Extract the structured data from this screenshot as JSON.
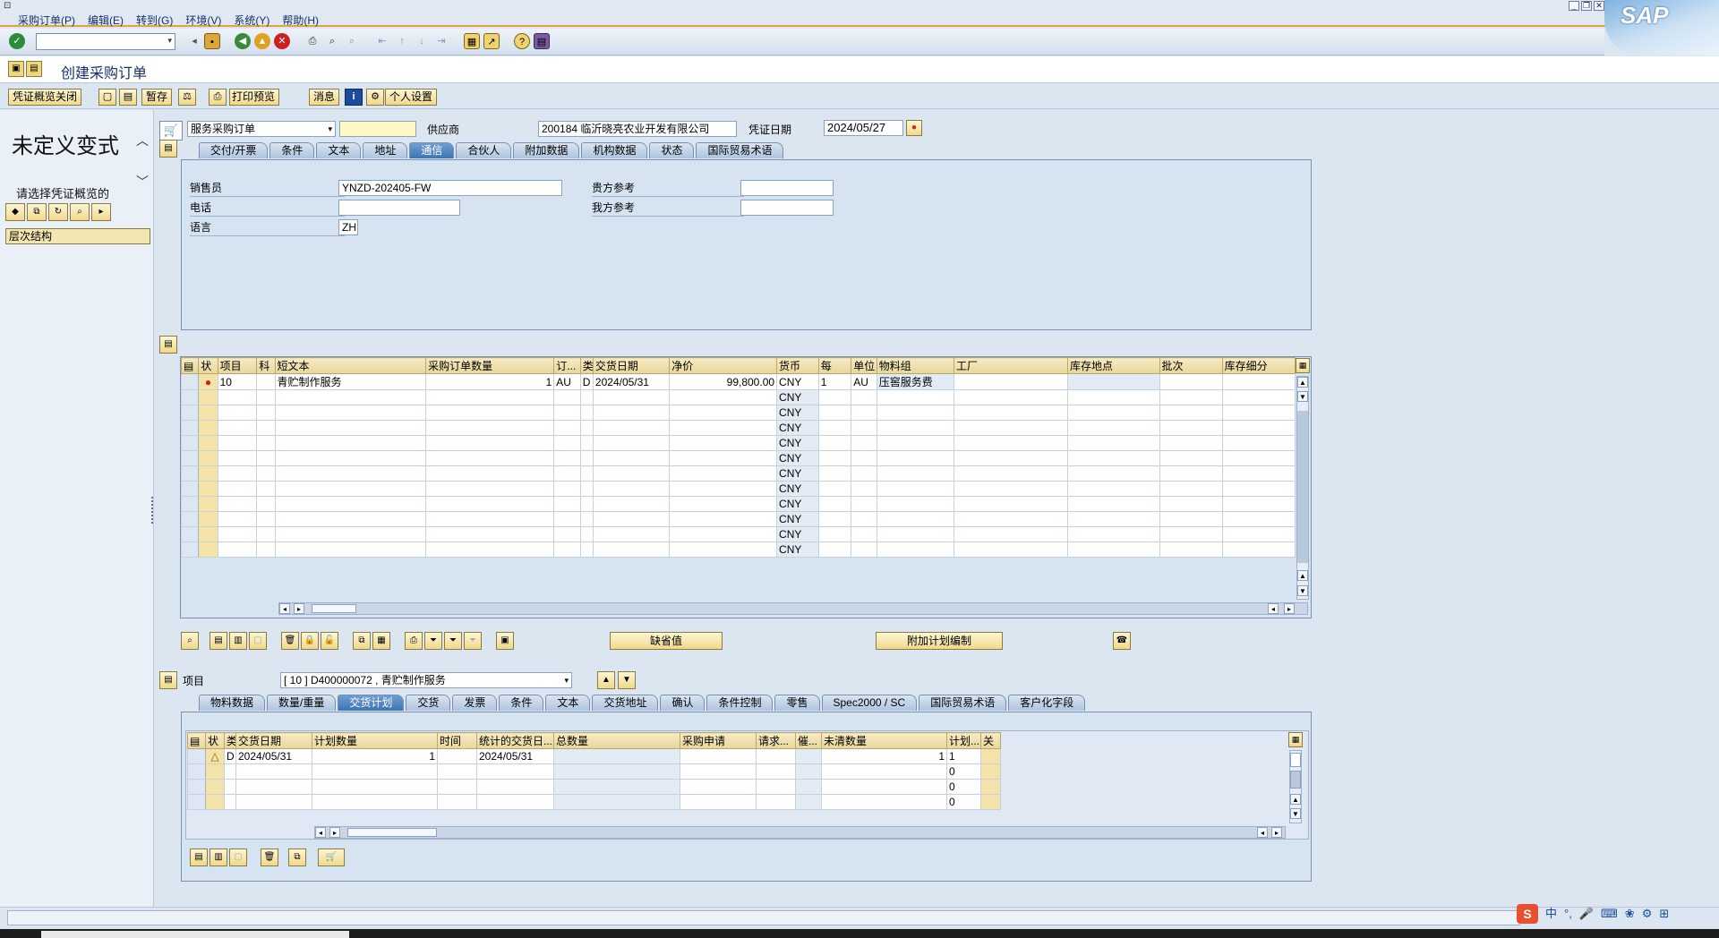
{
  "menu": [
    "采购订单(P)",
    "编辑(E)",
    "转到(G)",
    "环境(V)",
    "系统(Y)",
    "帮助(H)"
  ],
  "brand": "SAP",
  "title": "创建采购订单",
  "app_toolbar": {
    "overview_close": "凭证概览关闭",
    "hold": "暂存",
    "print_preview": "打印预览",
    "messages": "消息",
    "personal_settings": "个人设置"
  },
  "left_panel": {
    "title": "未定义变式",
    "prompt": "请选择凭证概览的",
    "tree_header": "层次结构"
  },
  "header": {
    "doc_type": "服务采购订单",
    "supplier_label": "供应商",
    "supplier_value": "200184 临沂晓亮农业开发有限公司",
    "doc_date_label": "凭证日期",
    "doc_date_value": "2024/05/27"
  },
  "header_tabs": [
    "交付/开票",
    "条件",
    "文本",
    "地址",
    "通信",
    "合伙人",
    "附加数据",
    "机构数据",
    "状态",
    "国际贸易术语"
  ],
  "header_active_tab": "通信",
  "communication": {
    "salesperson_label": "销售员",
    "salesperson_value": "YNZD-202405-FW",
    "phone_label": "电话",
    "language_label": "语言",
    "language_value": "ZH",
    "your_ref_label": "贵方参考",
    "our_ref_label": "我方参考"
  },
  "item_grid": {
    "columns": [
      "状",
      "项目",
      "科",
      "短文本",
      "采购订单数量",
      "订...",
      "类",
      "交货日期",
      "净价",
      "货币",
      "每",
      "单位",
      "物料组",
      "工厂",
      "库存地点",
      "批次",
      "库存细分"
    ],
    "row": {
      "item": "10",
      "short_text": "青贮制作服务",
      "qty": "1",
      "uom": "AU",
      "cat": "D",
      "delivery_date": "2024/05/31",
      "net_price": "99,800.00",
      "currency": "CNY",
      "per": "1",
      "unit": "AU",
      "material_group": "压窖服务费"
    },
    "empty_currency": "CNY"
  },
  "item_buttons": {
    "default_values": "缺省值",
    "add_planning": "附加计划编制"
  },
  "item_detail": {
    "label": "项目",
    "selector": "[ 10 ] D400000072 , 青贮制作服务"
  },
  "item_tabs": [
    "物料数据",
    "数量/重量",
    "交货计划",
    "交货",
    "发票",
    "条件",
    "文本",
    "交货地址",
    "确认",
    "条件控制",
    "零售",
    "Spec2000 / SC",
    "国际贸易术语",
    "客户化字段"
  ],
  "item_active_tab": "交货计划",
  "schedule_grid": {
    "columns": [
      "状",
      "类",
      "交货日期",
      "计划数量",
      "时间",
      "统计的交货日...",
      "总数量",
      "采购申请",
      "请求...",
      "催...",
      "未清数量",
      "计划...",
      "关"
    ],
    "row": {
      "cat": "D",
      "delivery_date": "2024/05/31",
      "qty": "1",
      "stat_date": "2024/05/31",
      "open_qty": "1",
      "plan": "1"
    },
    "empty_plan": "0"
  },
  "ime": [
    "中",
    "°,",
    "⌨"
  ]
}
